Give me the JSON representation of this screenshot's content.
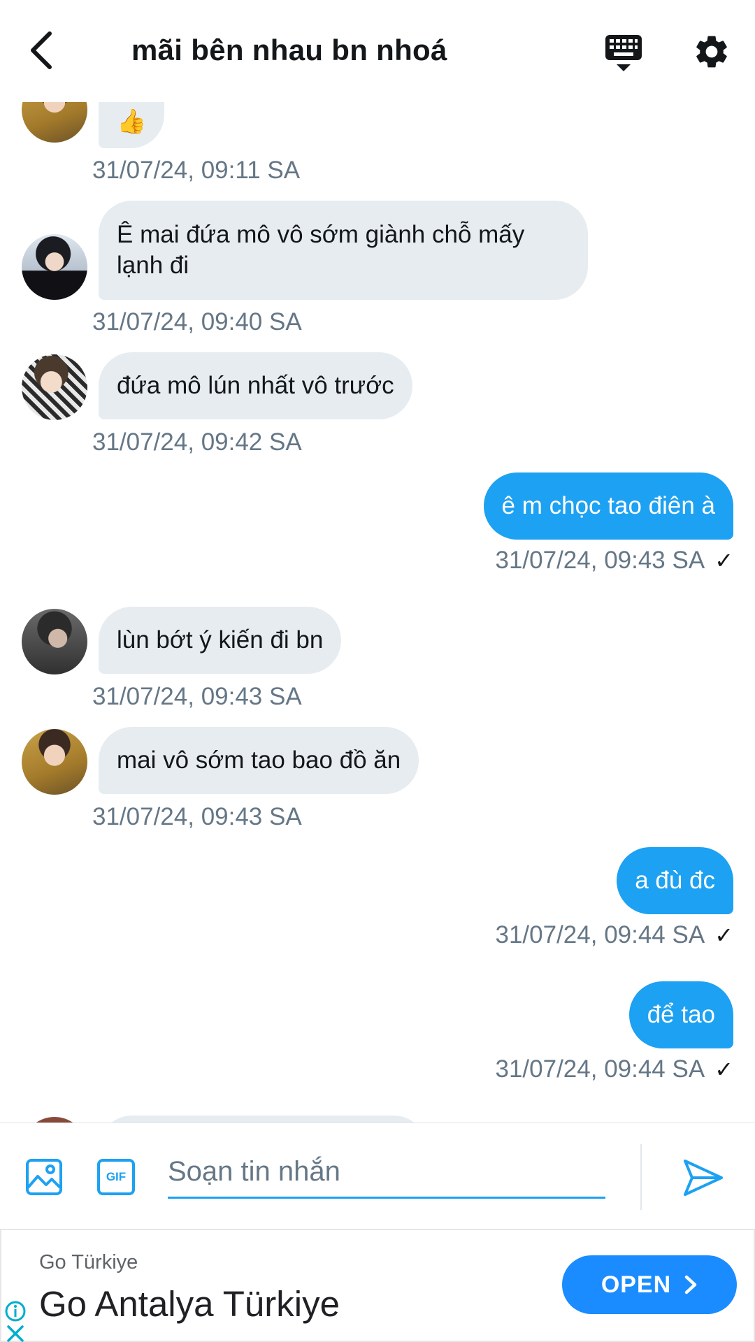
{
  "header": {
    "title": "mãi bên nhau bn nhoá",
    "back_icon": "chevron-left-icon",
    "keyboard_icon": "keyboard-icon",
    "settings_icon": "gear-icon"
  },
  "messages": [
    {
      "dir": "in",
      "text": "👍",
      "time": "31/07/24, 09:11 SA",
      "avatar": "avatar-yellow-jacket"
    },
    {
      "dir": "in",
      "text": "Ê mai đứa mô vô sớm giành chỗ mấy lạnh đi",
      "time": "31/07/24, 09:40 SA",
      "avatar": "avatar-black-outfit"
    },
    {
      "dir": "in",
      "text": "đứa mô lún nhất vô trước",
      "time": "31/07/24, 09:42 SA",
      "avatar": "avatar-plaid-shirt"
    },
    {
      "dir": "out",
      "text": "ê m chọc tao điên à",
      "time": "31/07/24, 09:43 SA"
    },
    {
      "dir": "in",
      "text": "lùn bớt ý kiến đi bn",
      "time": "31/07/24, 09:43 SA",
      "avatar": "avatar-dark-portrait"
    },
    {
      "dir": "in",
      "text": "mai vô sớm tao bao đồ ăn",
      "time": "31/07/24, 09:43 SA",
      "avatar": "avatar-yellow-jacket"
    },
    {
      "dir": "out",
      "text": "a đù đc",
      "time": "31/07/24, 09:44 SA"
    },
    {
      "dir": "out",
      "text": "để tao",
      "time": "31/07/24, 09:44 SA"
    }
  ],
  "read_mark": "✓",
  "composer": {
    "placeholder": "Soạn tin nhắn",
    "value": "",
    "image_icon": "image-icon",
    "gif_label": "GIF",
    "send_icon": "send-icon"
  },
  "ad": {
    "brand": "Go Türkiye",
    "headline": "Go Antalya Türkiye",
    "cta": "OPEN",
    "info_icon": "info-icon",
    "close_icon": "close-icon"
  },
  "colors": {
    "accent": "#1da1f2",
    "incoming_bubble": "#e6ecf0",
    "timestamp": "#657786",
    "ad_button": "#1a8cff"
  }
}
